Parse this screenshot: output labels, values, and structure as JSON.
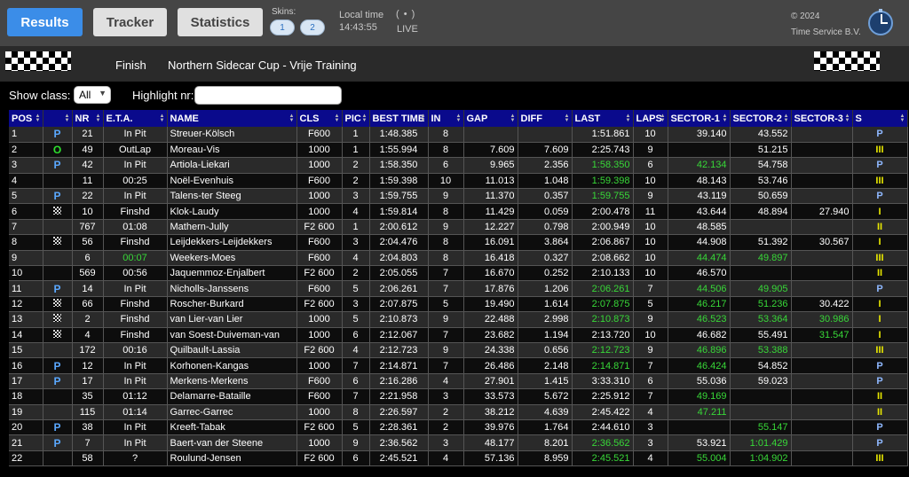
{
  "topbar": {
    "tabs": [
      "Results",
      "Tracker",
      "Statistics"
    ],
    "skins_label": "Skins:",
    "skins": [
      "1",
      "2"
    ],
    "localtime_label": "Local time",
    "localtime": "14:43:55",
    "live_icon": "( • )",
    "live": "LIVE",
    "copyright": "© 2024",
    "company": "Time Service B.V.",
    "logo_icon": "timer-logo-icon"
  },
  "header": {
    "status": "Finish",
    "event": "Northern Sidecar Cup - Vrije Training"
  },
  "filters": {
    "class_label": "Show class:",
    "class_value": "All",
    "highlight_label": "Highlight nr:",
    "highlight_value": ""
  },
  "colors": {
    "accent": "#3b8de8",
    "table_header": "#0a0a8c",
    "best": "#38d838",
    "sector": "#e8e800"
  },
  "table": {
    "columns": [
      "POS",
      "",
      "NR",
      "E.T.A.",
      "NAME",
      "CLS",
      "PIC",
      "BEST TIME",
      "IN",
      "GAP",
      "DIFF",
      "LAST",
      "LAPS",
      "SECTOR-1",
      "SECTOR-2",
      "SECTOR-3",
      "S"
    ],
    "rows": [
      {
        "pos": "1",
        "state": "P",
        "nr": "21",
        "eta": "In Pit",
        "name": "Streuer-Kölsch",
        "cls": "F600",
        "pic": "1",
        "best": "1:48.385",
        "in": "8",
        "gap": "",
        "diff": "",
        "last": "1:51.861",
        "laps": "10",
        "s1": "39.140",
        "s2": "43.552",
        "s3": "",
        "s": "P",
        "g": []
      },
      {
        "pos": "2",
        "state": "O",
        "nr": "49",
        "eta": "OutLap",
        "name": "Moreau-Vis",
        "cls": "1000",
        "pic": "1",
        "best": "1:55.994",
        "in": "8",
        "gap": "7.609",
        "diff": "7.609",
        "last": "2:25.743",
        "laps": "9",
        "s1": "",
        "s2": "51.215",
        "s3": "",
        "s": "III",
        "g": []
      },
      {
        "pos": "3",
        "state": "P",
        "nr": "42",
        "eta": "In Pit",
        "name": "Artiola-Liekari",
        "cls": "1000",
        "pic": "2",
        "best": "1:58.350",
        "in": "6",
        "gap": "9.965",
        "diff": "2.356",
        "last": "1:58.350",
        "laps": "6",
        "s1": "42.134",
        "s2": "54.758",
        "s3": "",
        "s": "P",
        "g": [
          "last",
          "s1"
        ]
      },
      {
        "pos": "4",
        "state": "",
        "nr": "11",
        "eta": "00:25",
        "name": "Noël-Evenhuis",
        "cls": "F600",
        "pic": "2",
        "best": "1:59.398",
        "in": "10",
        "gap": "11.013",
        "diff": "1.048",
        "last": "1:59.398",
        "laps": "10",
        "s1": "48.143",
        "s2": "53.746",
        "s3": "",
        "s": "III",
        "g": [
          "last"
        ]
      },
      {
        "pos": "5",
        "state": "P",
        "nr": "22",
        "eta": "In Pit",
        "name": "Talens-ter Steeg",
        "cls": "1000",
        "pic": "3",
        "best": "1:59.755",
        "in": "9",
        "gap": "11.370",
        "diff": "0.357",
        "last": "1:59.755",
        "laps": "9",
        "s1": "43.119",
        "s2": "50.659",
        "s3": "",
        "s": "P",
        "g": [
          "last"
        ]
      },
      {
        "pos": "6",
        "state": "F",
        "nr": "10",
        "eta": "Finshd",
        "name": "Klok-Laudy",
        "cls": "1000",
        "pic": "4",
        "best": "1:59.814",
        "in": "8",
        "gap": "11.429",
        "diff": "0.059",
        "last": "2:00.478",
        "laps": "11",
        "s1": "43.644",
        "s2": "48.894",
        "s3": "27.940",
        "s": "I",
        "g": []
      },
      {
        "pos": "7",
        "state": "",
        "nr": "767",
        "eta": "01:08",
        "name": "Mathern-Jully",
        "cls": "F2 600",
        "pic": "1",
        "best": "2:00.612",
        "in": "9",
        "gap": "12.227",
        "diff": "0.798",
        "last": "2:00.949",
        "laps": "10",
        "s1": "48.585",
        "s2": "",
        "s3": "",
        "s": "II",
        "g": []
      },
      {
        "pos": "8",
        "state": "F",
        "nr": "56",
        "eta": "Finshd",
        "name": "Leijdekkers-Leijdekkers",
        "cls": "F600",
        "pic": "3",
        "best": "2:04.476",
        "in": "8",
        "gap": "16.091",
        "diff": "3.864",
        "last": "2:06.867",
        "laps": "10",
        "s1": "44.908",
        "s2": "51.392",
        "s3": "30.567",
        "s": "I",
        "g": []
      },
      {
        "pos": "9",
        "state": "",
        "nr": "6",
        "eta": "00:07",
        "name": "Weekers-Moes",
        "cls": "F600",
        "pic": "4",
        "best": "2:04.803",
        "in": "8",
        "gap": "16.418",
        "diff": "0.327",
        "last": "2:08.662",
        "laps": "10",
        "s1": "44.474",
        "s2": "49.897",
        "s3": "",
        "s": "III",
        "g": [
          "eta",
          "s1",
          "s2"
        ]
      },
      {
        "pos": "10",
        "state": "",
        "nr": "569",
        "eta": "00:56",
        "name": "Jaquemmoz-Enjalbert",
        "cls": "F2 600",
        "pic": "2",
        "best": "2:05.055",
        "in": "7",
        "gap": "16.670",
        "diff": "0.252",
        "last": "2:10.133",
        "laps": "10",
        "s1": "46.570",
        "s2": "",
        "s3": "",
        "s": "II",
        "g": []
      },
      {
        "pos": "11",
        "state": "P",
        "nr": "14",
        "eta": "In Pit",
        "name": "Nicholls-Janssens",
        "cls": "F600",
        "pic": "5",
        "best": "2:06.261",
        "in": "7",
        "gap": "17.876",
        "diff": "1.206",
        "last": "2:06.261",
        "laps": "7",
        "s1": "44.506",
        "s2": "49.905",
        "s3": "",
        "s": "P",
        "g": [
          "last",
          "s1",
          "s2"
        ]
      },
      {
        "pos": "12",
        "state": "F",
        "nr": "66",
        "eta": "Finshd",
        "name": "Roscher-Burkard",
        "cls": "F2 600",
        "pic": "3",
        "best": "2:07.875",
        "in": "5",
        "gap": "19.490",
        "diff": "1.614",
        "last": "2:07.875",
        "laps": "5",
        "s1": "46.217",
        "s2": "51.236",
        "s3": "30.422",
        "s": "I",
        "g": [
          "last",
          "s1",
          "s2"
        ]
      },
      {
        "pos": "13",
        "state": "F",
        "nr": "2",
        "eta": "Finshd",
        "name": "van Lier-van Lier",
        "cls": "1000",
        "pic": "5",
        "best": "2:10.873",
        "in": "9",
        "gap": "22.488",
        "diff": "2.998",
        "last": "2:10.873",
        "laps": "9",
        "s1": "46.523",
        "s2": "53.364",
        "s3": "30.986",
        "s": "I",
        "g": [
          "last",
          "s1",
          "s2",
          "s3"
        ]
      },
      {
        "pos": "14",
        "state": "F",
        "nr": "4",
        "eta": "Finshd",
        "name": "van Soest-Duiveman-van",
        "cls": "1000",
        "pic": "6",
        "best": "2:12.067",
        "in": "7",
        "gap": "23.682",
        "diff": "1.194",
        "last": "2:13.720",
        "laps": "10",
        "s1": "46.682",
        "s2": "55.491",
        "s3": "31.547",
        "s": "I",
        "g": [
          "s3"
        ]
      },
      {
        "pos": "15",
        "state": "",
        "nr": "172",
        "eta": "00:16",
        "name": "Quilbault-Lassia",
        "cls": "F2 600",
        "pic": "4",
        "best": "2:12.723",
        "in": "9",
        "gap": "24.338",
        "diff": "0.656",
        "last": "2:12.723",
        "laps": "9",
        "s1": "46.896",
        "s2": "53.388",
        "s3": "",
        "s": "III",
        "g": [
          "last",
          "s1",
          "s2"
        ]
      },
      {
        "pos": "16",
        "state": "P",
        "nr": "12",
        "eta": "In Pit",
        "name": "Korhonen-Kangas",
        "cls": "1000",
        "pic": "7",
        "best": "2:14.871",
        "in": "7",
        "gap": "26.486",
        "diff": "2.148",
        "last": "2:14.871",
        "laps": "7",
        "s1": "46.424",
        "s2": "54.852",
        "s3": "",
        "s": "P",
        "g": [
          "last",
          "s1"
        ]
      },
      {
        "pos": "17",
        "state": "P",
        "nr": "17",
        "eta": "In Pit",
        "name": "Merkens-Merkens",
        "cls": "F600",
        "pic": "6",
        "best": "2:16.286",
        "in": "4",
        "gap": "27.901",
        "diff": "1.415",
        "last": "3:33.310",
        "laps": "6",
        "s1": "55.036",
        "s2": "59.023",
        "s3": "",
        "s": "P",
        "g": []
      },
      {
        "pos": "18",
        "state": "",
        "nr": "35",
        "eta": "01:12",
        "name": "Delamarre-Bataille",
        "cls": "F600",
        "pic": "7",
        "best": "2:21.958",
        "in": "3",
        "gap": "33.573",
        "diff": "5.672",
        "last": "2:25.912",
        "laps": "7",
        "s1": "49.169",
        "s2": "",
        "s3": "",
        "s": "II",
        "g": [
          "s1"
        ]
      },
      {
        "pos": "19",
        "state": "",
        "nr": "115",
        "eta": "01:14",
        "name": "Garrec-Garrec",
        "cls": "1000",
        "pic": "8",
        "best": "2:26.597",
        "in": "2",
        "gap": "38.212",
        "diff": "4.639",
        "last": "2:45.422",
        "laps": "4",
        "s1": "47.211",
        "s2": "",
        "s3": "",
        "s": "II",
        "g": [
          "s1"
        ]
      },
      {
        "pos": "20",
        "state": "P",
        "nr": "38",
        "eta": "In Pit",
        "name": "Kreeft-Tabak",
        "cls": "F2 600",
        "pic": "5",
        "best": "2:28.361",
        "in": "2",
        "gap": "39.976",
        "diff": "1.764",
        "last": "2:44.610",
        "laps": "3",
        "s1": "",
        "s2": "55.147",
        "s3": "",
        "s": "P",
        "g": [
          "s2"
        ]
      },
      {
        "pos": "21",
        "state": "P",
        "nr": "7",
        "eta": "In Pit",
        "name": "Baert-van der Steene",
        "cls": "1000",
        "pic": "9",
        "best": "2:36.562",
        "in": "3",
        "gap": "48.177",
        "diff": "8.201",
        "last": "2:36.562",
        "laps": "3",
        "s1": "53.921",
        "s2": "1:01.429",
        "s3": "",
        "s": "P",
        "g": [
          "last",
          "s2"
        ]
      },
      {
        "pos": "22",
        "state": "",
        "nr": "58",
        "eta": "?",
        "name": "Roulund-Jensen",
        "cls": "F2 600",
        "pic": "6",
        "best": "2:45.521",
        "in": "4",
        "gap": "57.136",
        "diff": "8.959",
        "last": "2:45.521",
        "laps": "4",
        "s1": "55.004",
        "s2": "1:04.902",
        "s3": "",
        "s": "III",
        "g": [
          "last",
          "s1",
          "s2"
        ]
      }
    ]
  }
}
